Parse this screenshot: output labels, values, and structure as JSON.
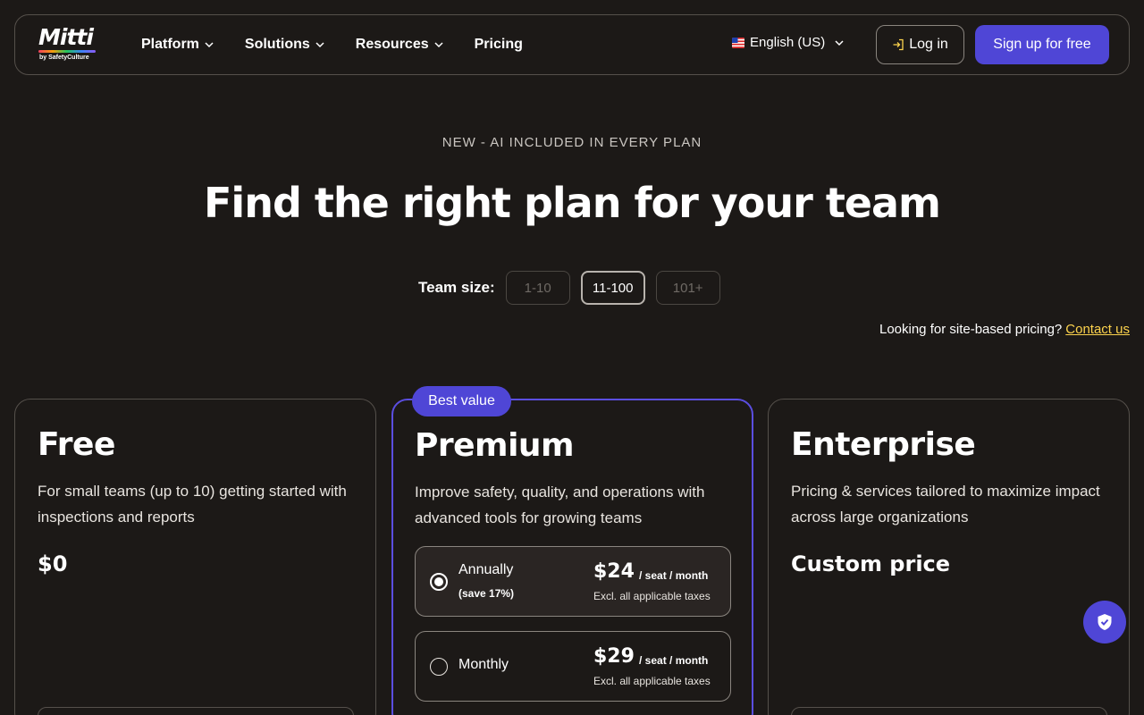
{
  "brand": {
    "name": "Mitti",
    "tagline": "by SafetyCulture"
  },
  "nav": {
    "links": [
      {
        "label": "Platform",
        "has_menu": true
      },
      {
        "label": "Solutions",
        "has_menu": true
      },
      {
        "label": "Resources",
        "has_menu": true
      },
      {
        "label": "Pricing",
        "has_menu": false
      }
    ],
    "language": "English (US)",
    "login_label": "Log in",
    "signup_label": "Sign up for free"
  },
  "hero": {
    "eyebrow": "NEW - AI INCLUDED IN EVERY PLAN",
    "title": "Find the right plan for your team"
  },
  "team_size": {
    "label": "Team size:",
    "options": [
      "1-10",
      "11-100",
      "101+"
    ],
    "selected": "11-100"
  },
  "site_pricing": {
    "text": "Looking for site-based pricing?",
    "link": "Contact us"
  },
  "plans": {
    "free": {
      "title": "Free",
      "description": "For small teams (up to 10) getting started with inspections and reports",
      "price": "$0"
    },
    "premium": {
      "badge": "Best value",
      "title": "Premium",
      "description": "Improve safety, quality, and operations with advanced tools for growing teams",
      "billing": [
        {
          "label": "Annually",
          "note": "(save 17%)",
          "price": "$24",
          "unit": "/ seat / month",
          "tax": "Excl. all applicable taxes",
          "selected": true
        },
        {
          "label": "Monthly",
          "note": "",
          "price": "$29",
          "unit": "/ seat / month",
          "tax": "Excl. all applicable taxes",
          "selected": false
        }
      ]
    },
    "enterprise": {
      "title": "Enterprise",
      "description": "Pricing & services tailored to maximize impact across large organizations",
      "price": "Custom price"
    }
  },
  "colors": {
    "background": "#1c1917",
    "accent": "#4f46d6",
    "link": "#fcd34d"
  },
  "icons": {
    "login": "login-arrow-icon",
    "chevron": "chevron-down-icon",
    "flag": "us-flag-icon",
    "fab": "shield-check-icon"
  }
}
